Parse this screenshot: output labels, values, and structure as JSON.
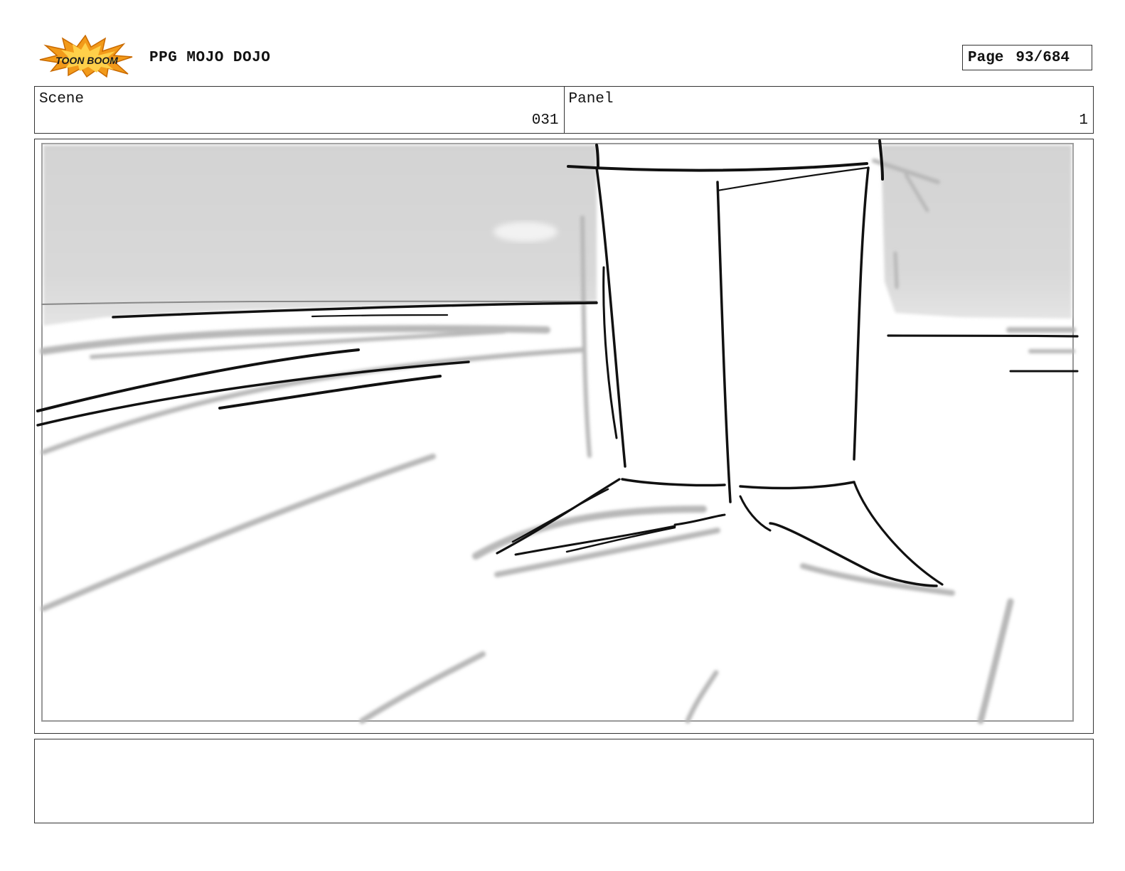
{
  "header": {
    "logo_text": "TOON BOOM",
    "title": "PPG MOJO DOJO",
    "page_label": "Page",
    "page_number": "93/684"
  },
  "info": {
    "scene_label": "Scene",
    "scene_value": "031",
    "panel_label": "Panel",
    "panel_value": "1"
  },
  "panel": {
    "drawing": "storyboard-sketch"
  },
  "notes": {
    "text": ""
  },
  "colors": {
    "logo_burst": "#f29a1a",
    "logo_text": "#1a1a1a",
    "sky_gray": "#d6d6d6",
    "ink": "#111111"
  }
}
